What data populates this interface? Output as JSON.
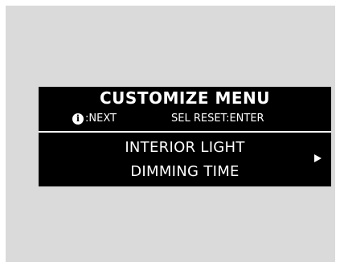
{
  "colors": {
    "background": "#dadadb",
    "display_background": "#000000",
    "display_text": "#ffffff"
  },
  "display": {
    "title": "CUSTOMIZE MENU",
    "hint_left": ":NEXT",
    "hint_left_icon": "info-icon",
    "hint_right": "SEL RESET:ENTER",
    "item_line1": "INTERIOR LIGHT",
    "item_line2": "DIMMING TIME",
    "item_arrow_icon": "right-triangle-icon"
  }
}
